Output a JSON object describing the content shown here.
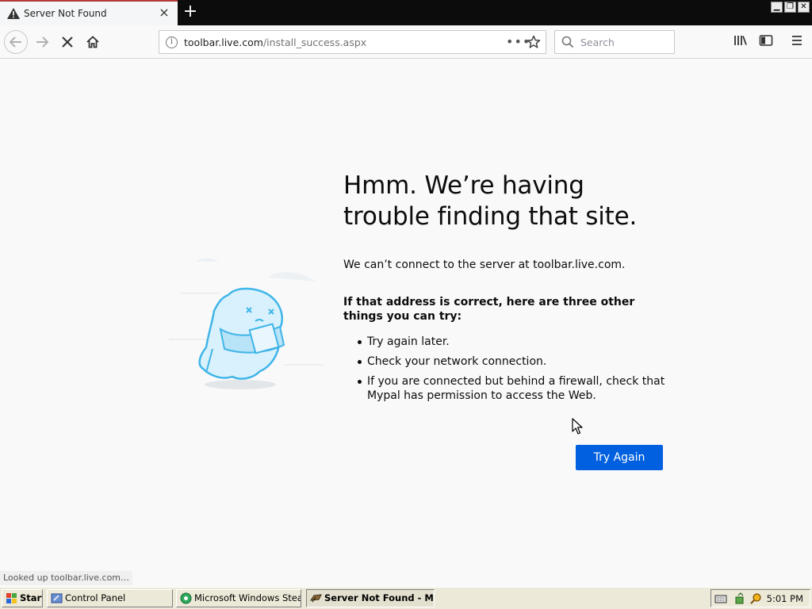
{
  "tab": {
    "title": "Server Not Found",
    "close": "×"
  },
  "newtab": "+",
  "window_buttons": {
    "minimize": "▁",
    "restore": "❐",
    "close": "✕"
  },
  "address_bar": {
    "url_host": "toolbar.live.com",
    "url_path": "/install_success.aspx",
    "info": "i",
    "dots": "•••"
  },
  "search": {
    "placeholder": "Search"
  },
  "error": {
    "heading": "Hmm. We’re having trouble finding that site.",
    "description": "We can’t connect to the server at toolbar.live.com.",
    "hint": "If that address is correct, here are three other things you can try:",
    "suggestions": [
      "Try again later.",
      "Check your network connection.",
      "If you are connected but behind a firewall, check that Mypal has permission to access the Web."
    ],
    "button": "Try Again"
  },
  "status_text": "Looked up toolbar.live.com…",
  "taskbar": {
    "start": "Start",
    "items": [
      "Control Panel",
      "Microsoft Windows Stea…",
      "Server Not Found - M…"
    ],
    "clock": "5:01 PM"
  }
}
